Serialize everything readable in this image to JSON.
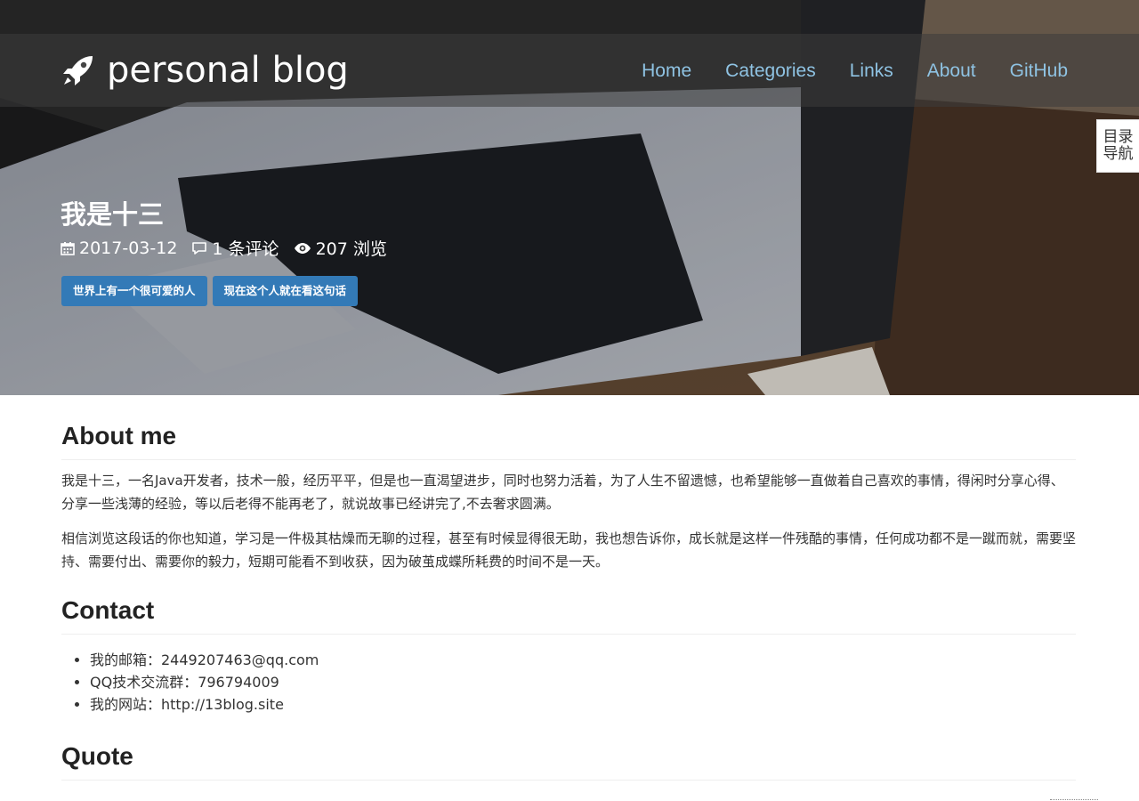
{
  "brand": {
    "name": "personal blog",
    "icon": "rocket-icon"
  },
  "nav": [
    {
      "label": "Home"
    },
    {
      "label": "Categories"
    },
    {
      "label": "Links"
    },
    {
      "label": "About"
    },
    {
      "label": "GitHub"
    }
  ],
  "toc": {
    "line1": "目录",
    "line2": "导航"
  },
  "post": {
    "title": "我是十三",
    "date": "2017-03-12",
    "comments": "1 条评论",
    "views": "207 浏览",
    "tags": [
      "世界上有一个很可爱的人",
      "现在这个人就在看这句话"
    ]
  },
  "sections": {
    "about": {
      "heading": "About me",
      "paragraphs": [
        "我是十三，一名Java开发者，技术一般，经历平平，但是也一直渴望进步，同时也努力活着，为了人生不留遗憾，也希望能够一直做着自己喜欢的事情，得闲时分享心得、分享一些浅薄的经验，等以后老得不能再老了，就说故事已经讲完了,不去奢求圆满。",
        "相信浏览这段话的你也知道，学习是一件极其枯燥而无聊的过程，甚至有时候显得很无助，我也想告诉你，成长就是这样一件残酷的事情，任何成功都不是一蹴而就，需要坚持、需要付出、需要你的毅力，短期可能看不到收获，因为破茧成蝶所耗费的时间不是一天。"
      ]
    },
    "contact": {
      "heading": "Contact",
      "items": [
        "我的邮箱：2449207463@qq.com",
        "QQ技术交流群：796794009",
        "我的网站：http://13blog.site"
      ]
    },
    "quote": {
      "heading": "Quote"
    }
  },
  "colors": {
    "nav_link": "#8fc3e3",
    "tag_bg": "#337ab7"
  }
}
